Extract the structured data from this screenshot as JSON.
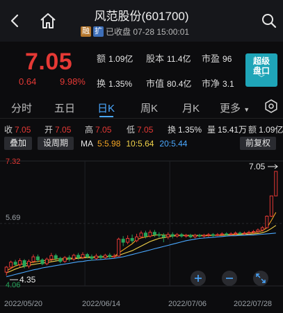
{
  "header": {
    "title": "风范股份(601700)",
    "badge_rong": "融",
    "badge_kuo": "扩",
    "status": "已收盘 07-28 15:00:01"
  },
  "quote": {
    "price": "7.05",
    "change": "0.64",
    "change_pct": "9.98%",
    "stats": [
      {
        "label": "额",
        "value": "1.09亿"
      },
      {
        "label": "股本",
        "value": "11.4亿"
      },
      {
        "label": "市盈",
        "value": "96"
      },
      {
        "label": "换",
        "value": "1.35%"
      },
      {
        "label": "市值",
        "value": "80.4亿"
      },
      {
        "label": "市净",
        "value": "3.1"
      }
    ],
    "super_button": {
      "line1": "超级",
      "line2": "盘口",
      "chevron": "﹀"
    }
  },
  "tabs": [
    {
      "label": "分时"
    },
    {
      "label": "五日"
    },
    {
      "label": "日K"
    },
    {
      "label": "周K"
    },
    {
      "label": "月K"
    },
    {
      "label": "更多"
    }
  ],
  "infobar": {
    "shou_label": "收",
    "shou": "7.05",
    "kai_label": "开",
    "kai": "7.05",
    "gao_label": "高",
    "gao": "7.05",
    "di_label": "低",
    "di": "7.05",
    "huan_label": "换",
    "huan": "1.35%",
    "liang": "量",
    "liang_v": "15.41万",
    "e_label": "额",
    "e_v": "1.09亿"
  },
  "controls": {
    "overlay": "叠加",
    "set_period": "设周期",
    "restore": "前复权",
    "ma_label": "MA",
    "ma5": "5:5.98",
    "ma10": "10:5.64",
    "ma20": "20:5.44"
  },
  "chart_data": {
    "type": "candlestick",
    "y_labels": {
      "top": "7.32",
      "mid": "5.69",
      "bottom": "4.06"
    },
    "annotations": {
      "high": "7.05",
      "low": "4.35"
    },
    "x_labels": [
      "2022/05/20",
      "2022/06/14",
      "2022/07/06",
      "2022/07/28"
    ],
    "ylim": [
      4.06,
      7.32
    ],
    "candles": [
      [
        4.42,
        4.55,
        4.33,
        4.58
      ],
      [
        4.55,
        4.68,
        4.5,
        4.72
      ],
      [
        4.68,
        4.62,
        4.58,
        4.74
      ],
      [
        4.62,
        4.72,
        4.55,
        4.78
      ],
      [
        4.72,
        4.58,
        4.52,
        4.76
      ],
      [
        4.58,
        4.7,
        4.52,
        4.75
      ],
      [
        4.7,
        4.82,
        4.66,
        4.88
      ],
      [
        4.82,
        4.74,
        4.68,
        4.88
      ],
      [
        4.74,
        4.64,
        4.6,
        4.78
      ],
      [
        4.64,
        4.76,
        4.6,
        4.8
      ],
      [
        4.76,
        4.85,
        4.7,
        4.92
      ],
      [
        4.85,
        4.78,
        4.72,
        4.9
      ],
      [
        4.78,
        4.7,
        4.65,
        4.82
      ],
      [
        4.7,
        4.8,
        4.66,
        4.84
      ],
      [
        4.8,
        4.76,
        4.7,
        4.86
      ],
      [
        4.76,
        4.86,
        4.72,
        4.9
      ],
      [
        4.86,
        4.8,
        4.75,
        4.92
      ],
      [
        4.8,
        4.88,
        4.76,
        4.94
      ],
      [
        4.88,
        4.82,
        4.78,
        4.92
      ],
      [
        4.82,
        4.78,
        4.72,
        4.88
      ],
      [
        4.78,
        4.84,
        4.74,
        4.9
      ],
      [
        4.84,
        4.8,
        4.76,
        4.88
      ],
      [
        4.8,
        4.86,
        4.76,
        4.9
      ],
      [
        4.86,
        4.82,
        4.78,
        4.92
      ],
      [
        4.82,
        4.84,
        4.78,
        4.9
      ],
      [
        4.84,
        5.28,
        4.82,
        5.32
      ],
      [
        5.28,
        5.2,
        5.1,
        5.36
      ],
      [
        5.2,
        5.3,
        5.15,
        5.38
      ],
      [
        5.3,
        5.24,
        5.18,
        5.4
      ],
      [
        5.24,
        5.34,
        5.2,
        5.42
      ],
      [
        5.34,
        5.44,
        5.3,
        5.5
      ],
      [
        5.44,
        5.36,
        5.3,
        5.5
      ],
      [
        5.36,
        5.46,
        5.32,
        5.52
      ],
      [
        5.46,
        5.4,
        5.34,
        5.52
      ],
      [
        5.4,
        5.38,
        5.32,
        5.46
      ],
      [
        5.38,
        5.34,
        5.2,
        5.44
      ],
      [
        5.34,
        5.4,
        5.28,
        5.46
      ],
      [
        5.4,
        5.36,
        5.3,
        5.46
      ],
      [
        5.36,
        5.4,
        5.32,
        5.44
      ],
      [
        5.4,
        5.36,
        5.32,
        5.44
      ],
      [
        5.36,
        5.38,
        5.32,
        5.42
      ],
      [
        5.38,
        5.34,
        5.3,
        5.42
      ],
      [
        5.34,
        5.38,
        5.3,
        5.42
      ],
      [
        5.38,
        5.36,
        5.32,
        5.42
      ],
      [
        5.36,
        5.38,
        5.32,
        5.42
      ],
      [
        5.38,
        5.4,
        5.34,
        5.44
      ],
      [
        5.4,
        5.38,
        5.34,
        5.44
      ],
      [
        5.38,
        5.4,
        5.36,
        5.44
      ],
      [
        5.4,
        5.42,
        5.36,
        5.46
      ],
      [
        5.42,
        5.4,
        5.36,
        5.46
      ],
      [
        5.4,
        5.42,
        5.38,
        5.46
      ],
      [
        5.42,
        5.44,
        5.38,
        5.48
      ],
      [
        5.44,
        5.42,
        5.4,
        5.48
      ],
      [
        5.42,
        5.44,
        5.4,
        5.48
      ],
      [
        5.44,
        5.46,
        5.4,
        5.5
      ],
      [
        5.46,
        5.48,
        5.42,
        5.52
      ],
      [
        5.48,
        5.52,
        5.44,
        5.56
      ],
      [
        5.52,
        5.58,
        5.48,
        5.62
      ],
      [
        5.58,
        5.88,
        5.56,
        5.9
      ],
      [
        5.88,
        6.41,
        5.86,
        6.41
      ],
      [
        6.41,
        7.05,
        6.41,
        7.05
      ]
    ],
    "ma5": [
      4.45,
      4.52,
      4.58,
      4.62,
      4.64,
      4.66,
      4.68,
      4.7,
      4.72,
      4.72,
      4.74,
      4.76,
      4.77,
      4.78,
      4.78,
      4.79,
      4.8,
      4.81,
      4.82,
      4.82,
      4.82,
      4.82,
      4.83,
      4.83,
      4.83,
      4.92,
      5.0,
      5.08,
      5.16,
      5.27,
      5.31,
      5.34,
      5.36,
      5.38,
      5.4,
      5.39,
      5.38,
      5.38,
      5.38,
      5.38,
      5.37,
      5.37,
      5.37,
      5.37,
      5.37,
      5.37,
      5.38,
      5.38,
      5.39,
      5.4,
      5.4,
      5.41,
      5.42,
      5.43,
      5.44,
      5.45,
      5.47,
      5.5,
      5.58,
      5.77,
      5.98
    ],
    "ma10": [
      4.4,
      4.45,
      4.5,
      4.54,
      4.57,
      4.6,
      4.62,
      4.64,
      4.66,
      4.67,
      4.69,
      4.71,
      4.73,
      4.75,
      4.76,
      4.77,
      4.78,
      4.79,
      4.8,
      4.8,
      4.81,
      4.81,
      4.82,
      4.82,
      4.82,
      4.86,
      4.9,
      4.94,
      4.98,
      5.04,
      5.1,
      5.16,
      5.22,
      5.26,
      5.3,
      5.32,
      5.34,
      5.36,
      5.37,
      5.38,
      5.38,
      5.38,
      5.38,
      5.38,
      5.38,
      5.38,
      5.38,
      5.38,
      5.38,
      5.39,
      5.39,
      5.4,
      5.4,
      5.41,
      5.41,
      5.42,
      5.43,
      5.45,
      5.49,
      5.56,
      5.64
    ],
    "ma20": [
      4.3,
      4.33,
      4.36,
      4.39,
      4.42,
      4.45,
      4.48,
      4.5,
      4.53,
      4.55,
      4.57,
      4.59,
      4.61,
      4.63,
      4.65,
      4.67,
      4.69,
      4.7,
      4.72,
      4.73,
      4.74,
      4.75,
      4.76,
      4.77,
      4.78,
      4.8,
      4.82,
      4.85,
      4.88,
      4.91,
      4.94,
      4.97,
      5.0,
      5.03,
      5.06,
      5.09,
      5.12,
      5.15,
      5.18,
      5.21,
      5.24,
      5.26,
      5.28,
      5.3,
      5.31,
      5.32,
      5.33,
      5.34,
      5.35,
      5.36,
      5.37,
      5.37,
      5.38,
      5.38,
      5.39,
      5.39,
      5.4,
      5.41,
      5.42,
      5.43,
      5.44
    ]
  },
  "chart_controls": {
    "zoom_in": "+",
    "zoom_out": "−"
  },
  "colors": {
    "up": "#e53935",
    "down": "#26a65b",
    "ma5": "#f5a623",
    "ma10": "#f2d34a",
    "ma20": "#4aa8ff",
    "accent": "#4aa8ff"
  }
}
